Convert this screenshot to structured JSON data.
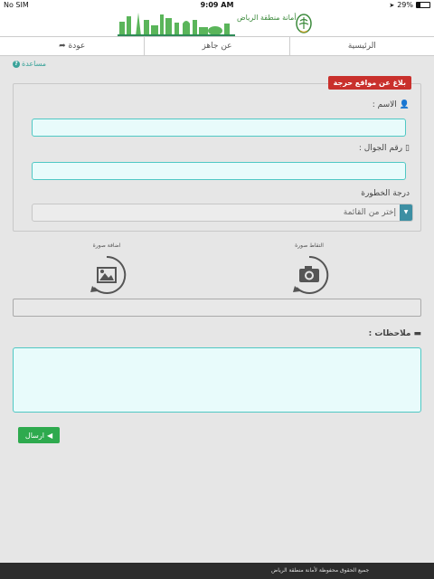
{
  "status_bar": {
    "carrier": "No SIM",
    "time": "9:09 AM",
    "battery": "29%",
    "battery_level": 0.29
  },
  "header": {
    "org_name": "أمانة منطقة الرياض",
    "colors": {
      "brand_green": "#3b8a3b"
    }
  },
  "nav": {
    "items": [
      {
        "label": "عودة",
        "icon": "share-arrow-icon"
      },
      {
        "label": "عن جاهز"
      },
      {
        "label": "الرئيسية"
      }
    ]
  },
  "help_link": "مساعدة",
  "form": {
    "legend": "بلاغ عن مواقع حرجة",
    "name_label": "الاسم :",
    "mobile_label": "رقم الجوال :",
    "severity_label": "درجة الخطورة",
    "severity_selected": "إختر من القائمة",
    "add_photo_label": "اضافة صورة",
    "capture_photo_label": "التقاط صورة",
    "notes_label": "ملاحظات :",
    "submit_label": "ارسال"
  },
  "colors": {
    "legend_red": "#c9302c",
    "field_border": "#4fc8c4",
    "submit_green": "#2eaa4e"
  },
  "footer": {
    "text": "جميع الحقوق محفوظة لأمانة منطقة الرياض"
  }
}
